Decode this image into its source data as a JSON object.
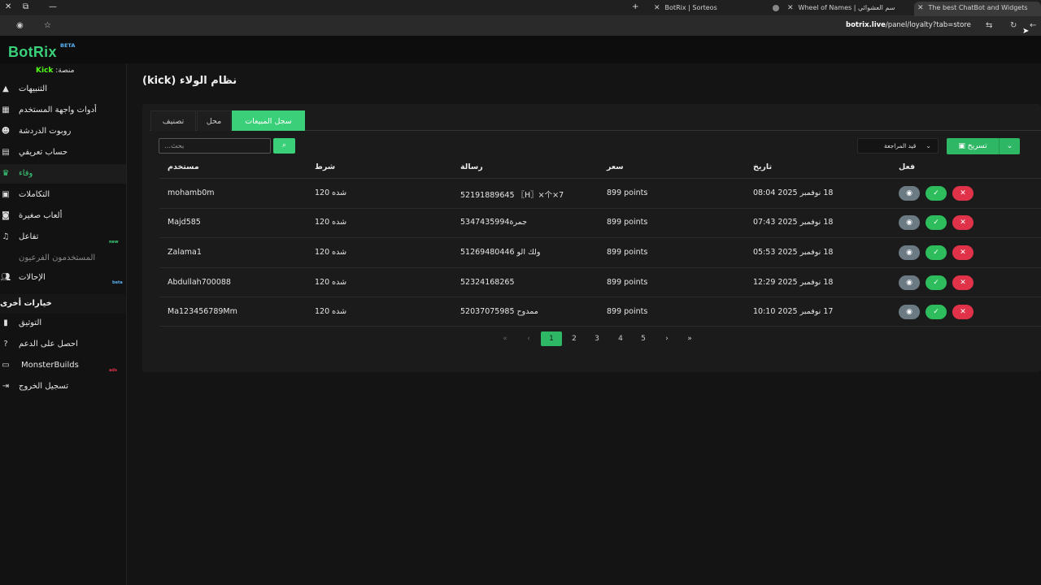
{
  "browser": {
    "tabs": [
      {
        "title": "BotRix | Sorteos",
        "active": false
      },
      {
        "title": "Wheel of Names | سم العشوائي",
        "active": false
      },
      {
        "title": "The best ChatBot and Widgets",
        "active": true
      }
    ],
    "url_domain": "botrix.live",
    "url_path": "/panel/loyalty?tab=store"
  },
  "app": {
    "logo": "BotRix",
    "beta": "BETA",
    "platform_label": "منصة:",
    "platform_name": "Kick"
  },
  "sidebar": {
    "items": [
      {
        "label": "التنبيهات",
        "icon": "warning-icon"
      },
      {
        "label": "أدوات واجهة المستخدم",
        "icon": "layout-icon"
      },
      {
        "label": "روبوت الدردشة",
        "icon": "robot-icon"
      },
      {
        "label": "حساب تعريفي",
        "icon": "id-card-icon"
      },
      {
        "label": "وفاء",
        "icon": "trophy-icon",
        "active": true
      },
      {
        "label": "التكاملات",
        "icon": "plug-icon"
      },
      {
        "label": "ألعاب صغيرة",
        "icon": "gamepad-icon"
      },
      {
        "label": "تفاعل",
        "icon": "music-icon",
        "badge": "new"
      },
      {
        "label": "المستخدمون الفرعيون",
        "icon": "",
        "muted": true
      },
      {
        "label": "الإحالات",
        "icon": "users-icon",
        "badge": "beta"
      }
    ],
    "section_title": "خيارات أخرى",
    "other": [
      {
        "label": "التوثيق",
        "icon": "book-icon"
      },
      {
        "label": "احصل على الدعم",
        "icon": "help-icon"
      },
      {
        "label": "MonsterBuilds",
        "icon": "laptop-icon",
        "badge": "ads"
      },
      {
        "label": "تسجيل الخروج",
        "icon": "logout-icon"
      }
    ]
  },
  "main": {
    "title": "نظام الولاء (kick)",
    "tabs": [
      "تصنيف",
      "محل",
      "سجل المبيعات"
    ],
    "active_tab": "سجل المبيعات",
    "search_placeholder": "...بحث",
    "filter_value": "قيد المراجعة",
    "export_label": "تسريح"
  },
  "table": {
    "headers": {
      "user": "مستخدم",
      "condition": "شرط",
      "message": "رسالة",
      "price": "سعر",
      "date": "تاريخ",
      "action": "فعل"
    },
    "rows": [
      {
        "user": "mohamb0m",
        "condition": "شده 120",
        "message": "5219188964​5 〖H〗×个×7",
        "price": "899 points",
        "date": "18 نوفمبر 2025 08:04"
      },
      {
        "user": "Majd585",
        "condition": "شده 120",
        "message": "5347435994جمرة",
        "price": "899 points",
        "date": "18 نوفمبر 2025 07:43"
      },
      {
        "user": "Zalama1",
        "condition": "شده 120",
        "message": "51269480446 ولك الو",
        "price": "899 points",
        "date": "18 نوفمبر 2025 05:53"
      },
      {
        "user": "Abdullah700088",
        "condition": "شده 120",
        "message": "52324168265",
        "price": "899 points",
        "date": "18 نوفمبر 2025 12:29"
      },
      {
        "user": "Ma123456789Mm",
        "condition": "شده 120",
        "message": "52037075985 ممدوح",
        "price": "899 points",
        "date": "17 نوفمبر 2025 10:10"
      }
    ]
  },
  "pagination": {
    "pages": [
      "1",
      "2",
      "3",
      "4",
      "5"
    ],
    "current": "1",
    "first": "«",
    "prev": "‹",
    "next": "›",
    "last": "»"
  }
}
